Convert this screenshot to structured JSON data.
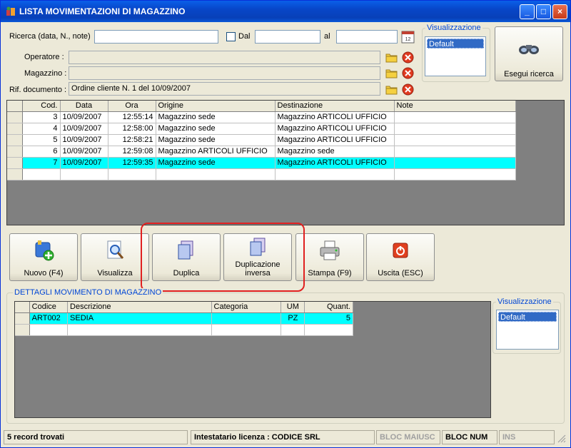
{
  "window": {
    "title": "LISTA MOVIMENTAZIONI DI MAGAZZINO",
    "minimize": "_",
    "maximize": "□",
    "close": "×"
  },
  "search": {
    "ricerca_label": "Ricerca (data, N., note)",
    "ricerca_value": "",
    "dal_label": "Dal",
    "dal_value": "",
    "al_label": "al",
    "al_value": "",
    "operatore_label": "Operatore :",
    "operatore_value": "",
    "magazzino_label": "Magazzino :",
    "magazzino_value": "",
    "rif_label": "Rif. documento :",
    "rif_value": "Ordine cliente N. 1 del 10/09/2007"
  },
  "visualizzazione_top": {
    "title": "Visualizzazione",
    "selected": "Default"
  },
  "esegui_ricerca": "Esegui ricerca",
  "movements": {
    "columns": [
      "Cod.",
      "Data",
      "Ora",
      "Origine",
      "Destinazione",
      "Note"
    ],
    "rows": [
      {
        "cod": "3",
        "data": "10/09/2007",
        "ora": "12:55:14",
        "origine": "Magazzino sede",
        "destinazione": "Magazzino ARTICOLI UFFICIO",
        "note": ""
      },
      {
        "cod": "4",
        "data": "10/09/2007",
        "ora": "12:58:00",
        "origine": "Magazzino sede",
        "destinazione": "Magazzino ARTICOLI UFFICIO",
        "note": ""
      },
      {
        "cod": "5",
        "data": "10/09/2007",
        "ora": "12:58:21",
        "origine": "Magazzino sede",
        "destinazione": "Magazzino ARTICOLI UFFICIO",
        "note": ""
      },
      {
        "cod": "6",
        "data": "10/09/2007",
        "ora": "12:59:08",
        "origine": "Magazzino ARTICOLI UFFICIO",
        "destinazione": "Magazzino sede",
        "note": ""
      },
      {
        "cod": "7",
        "data": "10/09/2007",
        "ora": "12:59:35",
        "origine": "Magazzino sede",
        "destinazione": "Magazzino ARTICOLI UFFICIO",
        "note": ""
      }
    ]
  },
  "toolbar": {
    "nuovo": "Nuovo (F4)",
    "visualizza": "Visualizza",
    "duplica": "Duplica",
    "duplicazione_1": "Duplicazione",
    "duplicazione_2": "inversa",
    "stampa": "Stampa (F9)",
    "uscita": "Uscita (ESC)"
  },
  "details": {
    "title": "DETTAGLI MOVIMENTO DI MAGAZZINO",
    "columns": [
      "Codice",
      "Descrizione",
      "Categoria",
      "UM",
      "Quant."
    ],
    "rows": [
      {
        "codice": "ART002",
        "descrizione": "SEDIA",
        "categoria": "",
        "um": "PZ",
        "quant": "5"
      }
    ]
  },
  "visualizzazione_bottom": {
    "title": "Visualizzazione",
    "selected": "Default"
  },
  "status": {
    "records": "5 record trovati",
    "license": "Intestatario licenza : CODICE SRL",
    "caps": "BLOC MAIUSC",
    "num": "BLOC NUM",
    "ins": "INS"
  },
  "colors": {
    "selected_row": "#00ffff",
    "title_blue": "#0a5fe8",
    "highlight": "#e02020"
  }
}
